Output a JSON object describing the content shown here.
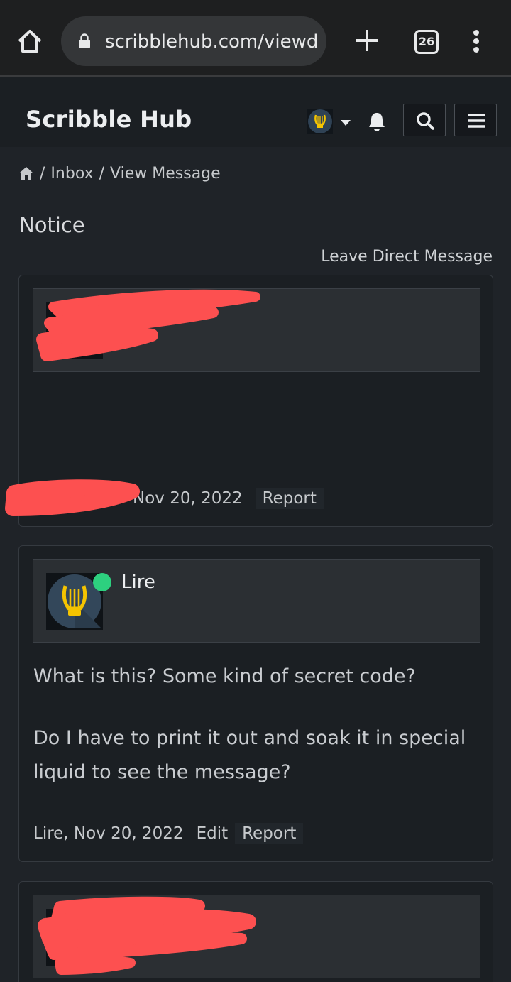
{
  "browser": {
    "url": "scribblehub.com/viewdm",
    "tab_count": "26"
  },
  "site": {
    "brand": "Scribble Hub"
  },
  "breadcrumb": {
    "sep": "/",
    "items": [
      "Inbox",
      "View Message"
    ]
  },
  "page": {
    "title": "Notice",
    "leave_dm": "Leave Direct Message"
  },
  "messages": [
    {
      "author": "",
      "date": "Nov 20, 2022",
      "actions": [
        "Report"
      ]
    },
    {
      "author": "Lire",
      "online": true,
      "body": [
        "What is this? Some kind of secret code?",
        "Do I have to print it out and soak it in special liquid to see the message?"
      ],
      "meta": "Lire, Nov 20, 2022",
      "actions": [
        "Edit",
        "Report"
      ]
    },
    {
      "author": ""
    }
  ],
  "colors": {
    "page_bg": "#1f2328",
    "card_bg": "#1b1f23",
    "author_bg": "#2b2f33",
    "online": "#2dd07f",
    "redaction": "#fd5050",
    "lyre": "#f5c400"
  },
  "icons": {
    "home": "home-icon",
    "lock": "lock-icon",
    "new_tab": "plus-icon",
    "menu": "kebab-icon",
    "bell": "bell-icon",
    "search": "search-icon",
    "hamburger": "hamburger-icon",
    "avatar": "lyre-icon"
  }
}
